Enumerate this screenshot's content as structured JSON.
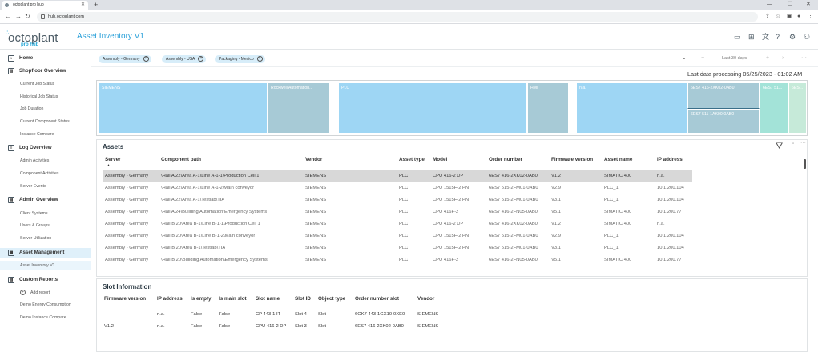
{
  "browser": {
    "tab_title": "octoplant pro hub",
    "url": "hub.octoplant.com"
  },
  "app": {
    "logo_text": "octoplant",
    "logo_sub": "pro hub",
    "page_title": "Asset Inventory V1"
  },
  "sidebar": {
    "home": "Home",
    "shopfloor": {
      "label": "Shopfloor Overview",
      "items": [
        "Current Job Status",
        "Historical Job Status",
        "Job Duration",
        "Current Component Status",
        "Instance Compare"
      ]
    },
    "log": {
      "label": "Log Overview",
      "items": [
        "Admin Activities",
        "Component Activities",
        "Server Events"
      ]
    },
    "admin": {
      "label": "Admin Overview",
      "items": [
        "Client Systems",
        "Users & Groups",
        "Server Utilization"
      ]
    },
    "asset": {
      "label": "Asset Management",
      "items": [
        "Asset Inventory V1"
      ]
    },
    "custom": {
      "label": "Custom Reports",
      "add": "Add report",
      "items": [
        "Demo Energy Consumption",
        "Demo Instance Compare"
      ]
    }
  },
  "filters": {
    "chips": [
      "Assembly - Germany",
      "Assembly - USA",
      "Packaging - Mexico"
    ],
    "time_range": "Last 30 days"
  },
  "last_processing": "Last data processing 05/25/2023 - 01:02 AM",
  "treemap": {
    "siemens": "SIEMENS",
    "rockwell": "Rockwell Automation...",
    "plc": "PLC",
    "hmi": "HMI",
    "na": "n.a.",
    "order1": "6ES7 416-2XK02-0AB0",
    "order2": "6ES7 511-1AK00-0AB0",
    "order3": "6ES7 51...",
    "order4": "6ES..."
  },
  "assets": {
    "title": "Assets",
    "columns": [
      "Server",
      "Component path",
      "Vendor",
      "Asset type",
      "Model",
      "Order number",
      "Firmware version",
      "Asset name",
      "IP address"
    ],
    "rows": [
      [
        "Assembly - Germany",
        "\\Hall A 22\\Area A-1\\Line A-1-1\\Production Cell 1",
        "SIEMENS",
        "PLC",
        "CPU 416-2 DP",
        "6ES7 416-2XK02-0AB0",
        "V1.2",
        "SIMATIC 400",
        "n.a."
      ],
      [
        "Assembly - Germany",
        "\\Hall A 22\\Area A-1\\Line A-1-2\\Main conveyor",
        "SIEMENS",
        "PLC",
        "CPU 1515F-2 PN",
        "6ES7 515-2FM01-0AB0",
        "V2.9",
        "PLC_1",
        "10.1.200.104"
      ],
      [
        "Assembly - Germany",
        "\\Hall A 22\\Area A-1\\Testlab\\TIA",
        "SIEMENS",
        "PLC",
        "CPU 1515F-2 PN",
        "6ES7 515-2FM01-0AB0",
        "V3.1",
        "PLC_1",
        "10.1.200.104"
      ],
      [
        "Assembly - Germany",
        "\\Hall A 24\\Building Automation\\Emergency Systems",
        "SIEMENS",
        "PLC",
        "CPU 416F-2",
        "6ES7 416-2FN05-0AB0",
        "V5.1",
        "SIMATIC 400",
        "10.1.200.77"
      ],
      [
        "Assembly - Germany",
        "\\Hall B 20\\Area B-1\\Line B-1-1\\Production Cell 1",
        "SIEMENS",
        "PLC",
        "CPU 416-2 DP",
        "6ES7 416-2XK02-0AB0",
        "V1.2",
        "SIMATIC 400",
        "n.a."
      ],
      [
        "Assembly - Germany",
        "\\Hall B 20\\Area B-1\\Line B-1-2\\Main conveyor",
        "SIEMENS",
        "PLC",
        "CPU 1515F-2 PN",
        "6ES7 515-2FM01-0AB0",
        "V2.9",
        "PLC_1",
        "10.1.200.104"
      ],
      [
        "Assembly - Germany",
        "\\Hall B 20\\Area B-1\\Testlab\\TIA",
        "SIEMENS",
        "PLC",
        "CPU 1515F-2 PN",
        "6ES7 515-2FM01-0AB0",
        "V3.1",
        "PLC_1",
        "10.1.200.104"
      ],
      [
        "Assembly - Germany",
        "\\Hall B 20\\Building Automation\\Emergency Systems",
        "SIEMENS",
        "PLC",
        "CPU 416F-2",
        "6ES7 416-2FN05-0AB0",
        "V5.1",
        "SIMATIC 400",
        "10.1.200.77"
      ]
    ]
  },
  "slots": {
    "title": "Slot Information",
    "columns": [
      "Firmware version",
      "IP address",
      "Is empty",
      "Is main slot",
      "Slot name",
      "Slot ID",
      "Object type",
      "Order number slot",
      "Vendor"
    ],
    "rows": [
      [
        "",
        "n.a.",
        "False",
        "False",
        "CP 443-1 IT",
        "Slot 4",
        "Slot",
        "6GK7 443-1GX10-0XE0",
        "SIEMENS"
      ],
      [
        "V1.2",
        "n.a.",
        "False",
        "False",
        "CPU 416-2 DP",
        "Slot 3",
        "Slot",
        "6ES7 416-2XK02-0AB0",
        "SIEMENS"
      ]
    ]
  },
  "colors": {
    "accent": "#2aa0d9",
    "treemap_blue": "#9ed6f4",
    "treemap_gray": "#a7cad6",
    "treemap_teal": "#a3e3d8"
  }
}
